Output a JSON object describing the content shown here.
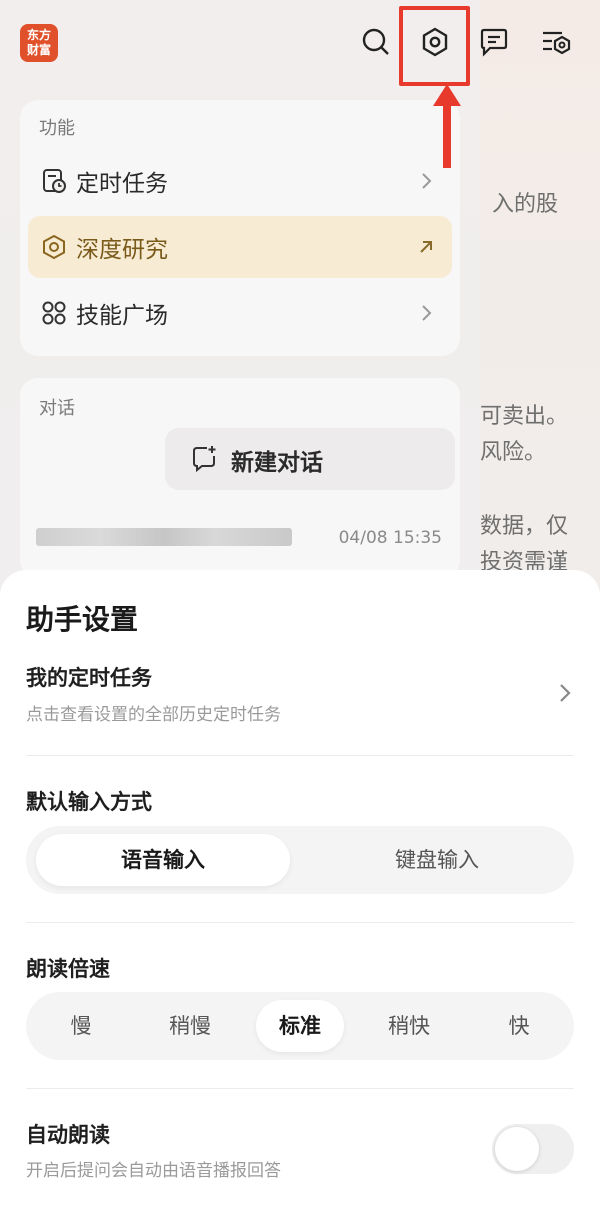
{
  "app": {
    "logo_text": "东方\n财富"
  },
  "background": {
    "fragments": [
      "入的股",
      "可卖出。",
      "风险。",
      "数据，仅",
      "投资需谨"
    ]
  },
  "drawer": {
    "features_label": "功能",
    "menu": [
      {
        "label": "定时任务"
      },
      {
        "label": "深度研究"
      },
      {
        "label": "技能广场"
      }
    ],
    "conversations_label": "对话",
    "new_chat_label": "新建对话",
    "recent_chat_time": "04/08 15:35"
  },
  "settings": {
    "title": "助手设置",
    "scheduled": {
      "title": "我的定时任务",
      "subtitle": "点击查看设置的全部历史定时任务"
    },
    "input_method": {
      "title": "默认输入方式",
      "options": [
        "语音输入",
        "键盘输入"
      ],
      "selected": "语音输入"
    },
    "read_speed": {
      "title": "朗读倍速",
      "options": [
        "慢",
        "稍慢",
        "标准",
        "稍快",
        "快"
      ],
      "selected": "标准"
    },
    "auto_read": {
      "title": "自动朗读",
      "subtitle": "开启后提问会自动由语音播报回答",
      "enabled": false
    }
  },
  "colors": {
    "highlight": "#e8392d",
    "logo": "#e0502a",
    "active_row": "#f6e6c4"
  }
}
